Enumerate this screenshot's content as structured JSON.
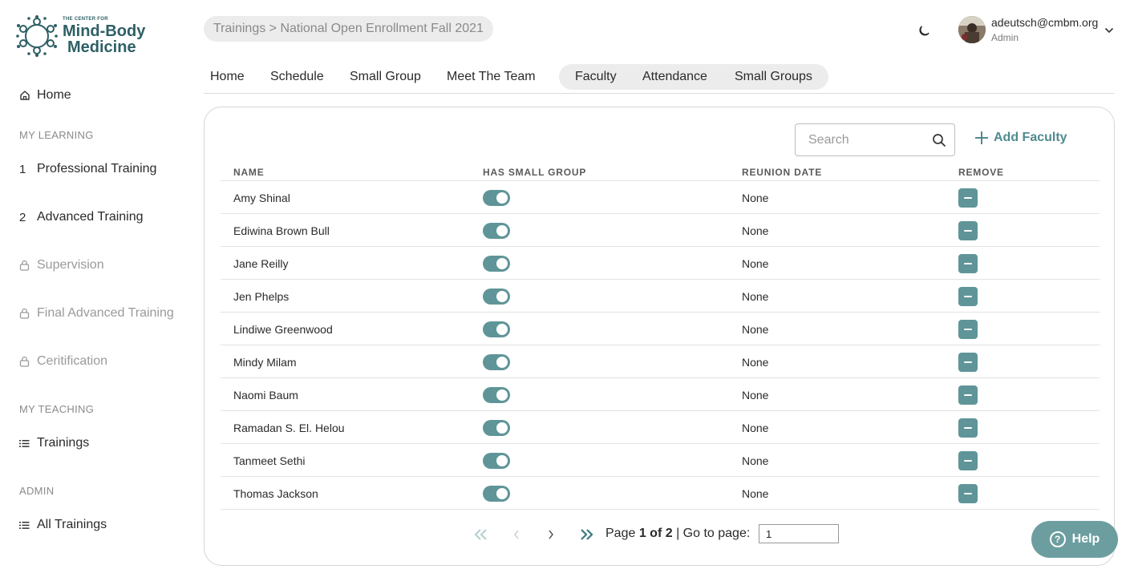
{
  "brand": {
    "line1": "THE CENTER FOR",
    "line2": "Mind-Body",
    "line3": "Medicine",
    "color": "#2e5f66"
  },
  "sidebar": {
    "home": "Home",
    "my_learning_label": "MY LEARNING",
    "learning_items": [
      {
        "num": "1",
        "label": "Professional Training",
        "locked": false
      },
      {
        "num": "2",
        "label": "Advanced Training",
        "locked": false
      },
      {
        "label": "Supervision",
        "locked": true,
        "icon": "lock-icon"
      },
      {
        "label": "Final Advanced Training",
        "locked": true,
        "icon": "lock-icon"
      },
      {
        "label": "Ceritification",
        "locked": true,
        "icon": "lock-icon"
      }
    ],
    "my_teaching_label": "MY TEACHING",
    "trainings": "Trainings",
    "admin_label": "ADMIN",
    "all_trainings": "All Trainings"
  },
  "header": {
    "breadcrumb": "Trainings > National Open Enrollment Fall 2021",
    "theme_icon": "moon-icon",
    "user_email": "adeutsch@cmbm.org",
    "user_role": "Admin"
  },
  "tabs": [
    "Home",
    "Schedule",
    "Small Group",
    "Meet The Team",
    "Faculty",
    "Attendance",
    "Small Groups"
  ],
  "toolbar": {
    "search_placeholder": "Search",
    "add_label": "Add Faculty"
  },
  "table": {
    "columns": [
      "NAME",
      "HAS SMALL GROUP",
      "REUNION DATE",
      "REMOVE"
    ],
    "rows": [
      {
        "name": "Amy Shinal",
        "has_small_group": true,
        "reunion_date": "None"
      },
      {
        "name": "Ediwina Brown Bull",
        "has_small_group": true,
        "reunion_date": "None"
      },
      {
        "name": "Jane Reilly",
        "has_small_group": true,
        "reunion_date": "None"
      },
      {
        "name": "Jen Phelps",
        "has_small_group": true,
        "reunion_date": "None"
      },
      {
        "name": "Lindiwe Greenwood",
        "has_small_group": true,
        "reunion_date": "None"
      },
      {
        "name": "Mindy Milam",
        "has_small_group": true,
        "reunion_date": "None"
      },
      {
        "name": "Naomi Baum",
        "has_small_group": true,
        "reunion_date": "None"
      },
      {
        "name": "Ramadan S. El. Helou",
        "has_small_group": true,
        "reunion_date": "None"
      },
      {
        "name": "Tanmeet Sethi",
        "has_small_group": true,
        "reunion_date": "None"
      },
      {
        "name": "Thomas Jackson",
        "has_small_group": true,
        "reunion_date": "None"
      }
    ]
  },
  "pagination": {
    "page_word": "Page",
    "page_of": "1 of 2",
    "go_to": "| Go to page:",
    "input_value": "1"
  },
  "help": {
    "label": "Help"
  },
  "colors": {
    "accent": "#5f9598",
    "help": "#6c9ea0",
    "pill": "#ececec"
  }
}
